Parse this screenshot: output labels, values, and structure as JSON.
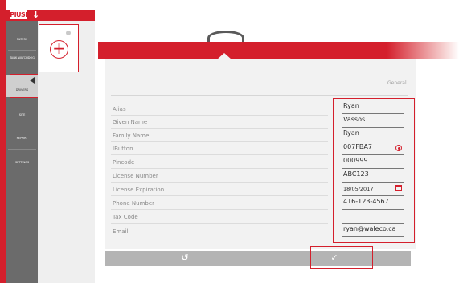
{
  "app": {
    "logo_text": "PIUSI",
    "back_arrow": "arrow-down-icon"
  },
  "sidebar": {
    "items": [
      {
        "id": "filters",
        "label": "Filters",
        "active": false
      },
      {
        "id": "tank-watchdog",
        "label": "Tank Watchdog",
        "active": false
      },
      {
        "id": "drivers",
        "label": "Drivers",
        "active": true
      },
      {
        "id": "site",
        "label": "Site",
        "active": false
      },
      {
        "id": "report",
        "label": "Report",
        "active": false
      },
      {
        "id": "settings",
        "label": "Settings",
        "active": false
      }
    ]
  },
  "subpanel": {
    "add_icon": "plus-circle-icon",
    "add_glyph": "+"
  },
  "form": {
    "section_title": "General",
    "fields": [
      {
        "label": "Alias",
        "value": "Ryan"
      },
      {
        "label": "Given Name",
        "value": "Vassos"
      },
      {
        "label": "Family Name",
        "value": "Ryan"
      },
      {
        "label": "IButton",
        "value": "007FBA7",
        "icon": "ibutton-icon"
      },
      {
        "label": "Pincode",
        "value": "000999"
      },
      {
        "label": "License Number",
        "value": "ABC123"
      },
      {
        "label": "License Expiration",
        "value": "18/05/2017",
        "icon": "calendar-icon"
      },
      {
        "label": "Phone Number",
        "value": "416-123-4567"
      },
      {
        "label": "Tax Code",
        "value": ""
      },
      {
        "label": "Email",
        "value": "ryan@waleco.ca"
      }
    ]
  },
  "actions": {
    "undo_glyph": "↺",
    "confirm_glyph": "✓"
  },
  "colors": {
    "accent": "#d41f2c",
    "sidebar": "#6b6b6b",
    "panel": "#f2f2f2"
  }
}
